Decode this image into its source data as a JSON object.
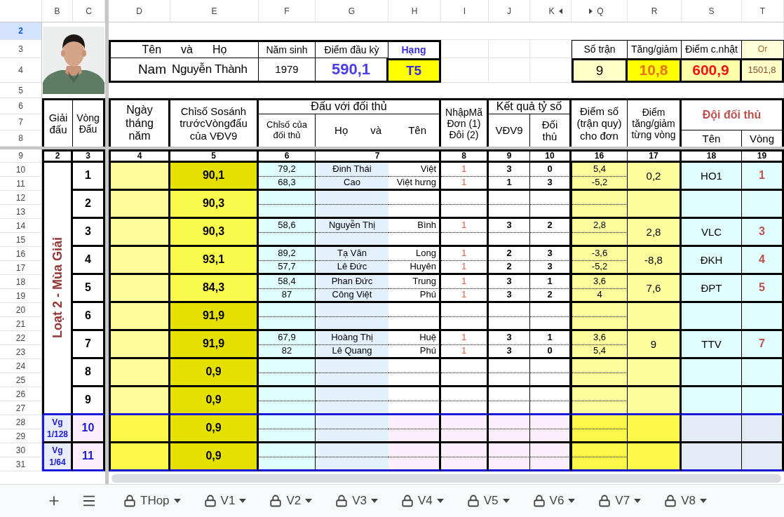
{
  "column_headers": [
    "B",
    "C",
    "D",
    "E",
    "F",
    "G",
    "H",
    "I",
    "J",
    "K",
    "Q",
    "R",
    "S",
    "T"
  ],
  "row_headers": [
    {
      "label": "2",
      "selected": true
    },
    {
      "label": "3",
      "selected": false
    },
    {
      "label": "4",
      "selected": false
    },
    {
      "label": "5",
      "selected": false
    },
    {
      "label": "6",
      "selected": false
    },
    {
      "label": "7",
      "selected": false
    },
    {
      "label": "8",
      "selected": false
    },
    {
      "label": "9",
      "selected": false
    },
    {
      "label": "10",
      "selected": false
    },
    {
      "label": "11",
      "selected": false
    },
    {
      "label": "12",
      "selected": false
    },
    {
      "label": "13",
      "selected": false
    },
    {
      "label": "14",
      "selected": false
    },
    {
      "label": "15",
      "selected": false
    },
    {
      "label": "16",
      "selected": false
    },
    {
      "label": "17",
      "selected": false
    },
    {
      "label": "18",
      "selected": false
    },
    {
      "label": "19",
      "selected": false
    },
    {
      "label": "20",
      "selected": false
    },
    {
      "label": "21",
      "selected": false
    },
    {
      "label": "22",
      "selected": false
    },
    {
      "label": "23",
      "selected": false
    },
    {
      "label": "24",
      "selected": false
    },
    {
      "label": "25",
      "selected": false
    },
    {
      "label": "26",
      "selected": false
    },
    {
      "label": "27",
      "selected": false
    },
    {
      "label": "28",
      "selected": false
    },
    {
      "label": "29",
      "selected": false
    },
    {
      "label": "30",
      "selected": false
    },
    {
      "label": "31",
      "selected": false
    }
  ],
  "profile": {
    "photo": {
      "kind": "picture"
    },
    "name_header": [
      "Tên",
      "và",
      "Họ"
    ],
    "gender": "Nam",
    "name": "Nguyễn Thành",
    "birth_year_header": "Năm sinh",
    "birth_year": "1979",
    "start_points_header": "Điểm đầu kỳ",
    "start_points": "590,1",
    "rank_header": "Hạng",
    "rank": "T5"
  },
  "summary": [
    {
      "kind": "count",
      "header": "Số trận",
      "value": "9"
    },
    {
      "kind": "change",
      "header": "Tăng/giảm",
      "value": "10,8"
    },
    {
      "kind": "current",
      "header": "Điểm c.nhật",
      "value": "600,9"
    },
    {
      "kind": "original",
      "header": "Or",
      "value": "1501,8"
    }
  ],
  "table": {
    "headers": {
      "tournament": "Giải\nđấu",
      "round": "Vòng\nĐấu",
      "date": "Ngày\ntháng\nnăm",
      "index": "Chỉsố Sosánh\ntrướcVòngđấu\ncủa VĐV9",
      "opponent_group": "Đấu với đối thủ",
      "opponent_index": "Chỉsố của\nđối thủ",
      "surname_label": "Họ",
      "conjunction": "và",
      "given_label": "Tên",
      "entry_code": "NhậpMã\nĐơn (1)\nĐôi (2)",
      "result_group": "Kết quả tỷ số",
      "player_score": "VĐV9",
      "opponent_score": "Đối\nthủ",
      "points": "Điểm số\n(trận quy)\ncho đơn",
      "round_change": "Điểm\ntăng/giảm\ntừng vòng",
      "team_group": "Đội đối thủ",
      "team_name": "Tên",
      "team_round": "Vòng"
    },
    "column_numbers": [
      "2",
      "3",
      "4",
      "5",
      "6",
      "7",
      "8",
      "9",
      "10",
      "16",
      "17",
      "18",
      "19"
    ],
    "section_label": "Loạt 2 - Mùa Giải",
    "rounds": [
      {
        "number": "1",
        "kind": "group",
        "index": "90,1",
        "color": "#e6e000",
        "matches": [
          {
            "rating": "79,2",
            "surname": "Đinh Thái",
            "given": "Việt",
            "code": "1",
            "score": "3",
            "opponent_score": "0",
            "points": "5,4"
          },
          {
            "rating": "68,3",
            "surname": "Cao",
            "given": "Việt hưng",
            "code": "1",
            "score": "1",
            "opponent_score": "3",
            "points": "-5,2"
          }
        ],
        "change": "0,2",
        "team": "HO1",
        "team_round": "1"
      },
      {
        "number": "2",
        "kind": "group",
        "index": "90,3",
        "color": "#fafa4c"
      },
      {
        "number": "3",
        "kind": "group",
        "index": "90,3",
        "color": "#fafa4c",
        "matches": [
          {
            "rating": "58,6",
            "surname": "Nguyễn Thị",
            "given": "Bình",
            "code": "1",
            "score": "3",
            "opponent_score": "2",
            "points": "2,8"
          }
        ],
        "change": "2,8",
        "team": "VLC",
        "team_round": "3"
      },
      {
        "number": "4",
        "kind": "group",
        "index": "93,1",
        "color": "#fafa4c",
        "matches": [
          {
            "rating": "89,2",
            "surname": "Tạ Văn",
            "given": "Long",
            "code": "1",
            "score": "2",
            "opponent_score": "3",
            "points": "-3,6"
          },
          {
            "rating": "57,7",
            "surname": "Lê Đức",
            "given": "Huyên",
            "code": "1",
            "score": "2",
            "opponent_score": "3",
            "points": "-5,2"
          }
        ],
        "change": "-8,8",
        "team": "ĐKH",
        "team_round": "4"
      },
      {
        "number": "5",
        "kind": "group",
        "index": "84,3",
        "color": "#fafa4c",
        "matches": [
          {
            "rating": "58,4",
            "surname": "Phan Đức",
            "given": "Trung",
            "code": "1",
            "score": "3",
            "opponent_score": "1",
            "points": "3,6"
          },
          {
            "rating": "87",
            "surname": "Công Việt",
            "given": "Phú",
            "code": "1",
            "score": "3",
            "opponent_score": "2",
            "points": "4"
          }
        ],
        "change": "7,6",
        "team": "ĐPT",
        "team_round": "5"
      },
      {
        "number": "6",
        "kind": "group",
        "index": "91,9",
        "color": "#e6e000"
      },
      {
        "number": "7",
        "kind": "group",
        "index": "91,9",
        "color": "#e6e000",
        "matches": [
          {
            "rating": "67,9",
            "surname": "Hoàng Thị",
            "given": "Huệ",
            "code": "1",
            "score": "3",
            "opponent_score": "1",
            "points": "3,6"
          },
          {
            "rating": "82",
            "surname": "Lê Quang",
            "given": "Phú",
            "code": "1",
            "score": "3",
            "opponent_score": "0",
            "points": "5,4"
          }
        ],
        "change": "9",
        "team": "TTV",
        "team_round": "7"
      },
      {
        "number": "8",
        "kind": "group",
        "index": "0,9",
        "color": "#e6e000"
      },
      {
        "number": "9",
        "kind": "group",
        "index": "0,9",
        "color": "#e6e000"
      },
      {
        "number": "10",
        "kind": "knockout",
        "stage_label": "Vg",
        "stage": "1/128",
        "index": "0,9",
        "color": "#e6e000"
      },
      {
        "number": "11",
        "kind": "knockout",
        "stage_label": "Vg",
        "stage": "1/64",
        "index": "0,9",
        "color": "#e6e000"
      }
    ]
  },
  "sheet_tabs": [
    {
      "label": "THop",
      "selected": false
    },
    {
      "label": "V1",
      "selected": false
    },
    {
      "label": "V2",
      "selected": false
    },
    {
      "label": "V3",
      "selected": false
    },
    {
      "label": "V4",
      "selected": false
    },
    {
      "label": "V5",
      "selected": false
    },
    {
      "label": "V6",
      "selected": false
    },
    {
      "label": "V7",
      "selected": false
    },
    {
      "label": "V8",
      "selected": false
    }
  ]
}
